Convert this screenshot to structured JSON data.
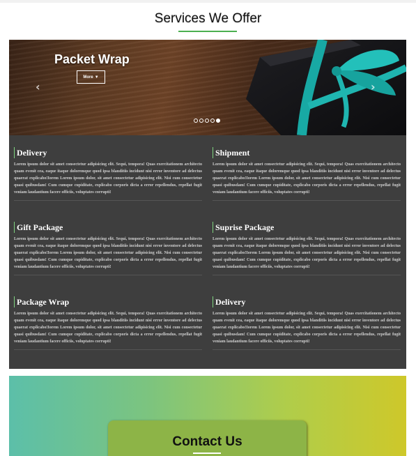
{
  "header": {
    "title": "Services We Offer"
  },
  "carousel": {
    "caption": "Packet Wrap",
    "more_label": "More",
    "prev_icon": "‹",
    "next_icon": "›",
    "indicators": 5,
    "active_indicator": 5
  },
  "services": [
    {
      "title": "Delivery",
      "text": "Lorem ipsum dolor sit amet consectetur adipisicing elit. Sequi, tempora! Quas exercitationem architecto quam evenit cea, eaque itaque doloremque quod ipsa blanditiis incidunt nisi error inventore ad delectus quaerat explicabo!Iorem Lorem ipsum dolor, sit amet consectetur adipisicing elit. Nisi cum consectetur quasi quibusdam! Cum cumque cupiditate, explicabo corporis dicta a error repellendus, repellat fugit veniam laudantium facere officiis, voluptates corrupti!"
    },
    {
      "title": "Shipment",
      "text": "Lorem ipsum dolor sit amet consectetur adipisicing elit. Sequi, tempora! Quas exercitationem architecto quam evenit cea, eaque itaque doloremque quod ipsa blanditiis incidunt nisi error inventore ad delectus quaerat explicabo!Iorem Lorem ipsum dolor, sit amet consectetur adipisicing elit. Nisi cum consectetur quasi quibusdam! Cum cumque cupiditate, explicabo corporis dicta a error repellendus, repellat fugit veniam laudantium facere officiis, voluptates corrupti!"
    },
    {
      "title": "Gift Package",
      "text": "Lorem ipsum dolor sit amet consectetur adipisicing elit. Sequi, tempora! Quas exercitationem architecto quam evenit cea, eaque itaque doloremque quod ipsa blanditiis incidunt nisi error inventore ad delectus quaerat explicabo!Iorem Lorem ipsum dolor, sit amet consectetur adipisicing elit. Nisi cum consectetur quasi quibusdam! Cum cumque cupiditate, explicabo corporis dicta a error repellendus, repellat fugit veniam laudantium facere officiis, voluptates corrupti!"
    },
    {
      "title": "Suprise Package",
      "text": "Lorem ipsum dolor sit amet consectetur adipisicing elit. Sequi, tempora! Quas exercitationem architecto quam evenit cea, eaque itaque doloremque quod ipsa blanditiis incidunt nisi error inventore ad delectus quaerat explicabo!Iorem Lorem ipsum dolor, sit amet consectetur adipisicing elit. Nisi cum consectetur quasi quibusdam! Cum cumque cupiditate, explicabo corporis dicta a error repellendus, repellat fugit veniam laudantium facere officiis, voluptates corrupti!"
    },
    {
      "title": "Package Wrap",
      "text": "Lorem ipsum dolor sit amet consectetur adipisicing elit. Sequi, tempora! Quas exercitationem architecto quam evenit cea, eaque itaque doloremque quod ipsa blanditiis incidunt nisi error inventore ad delectus quaerat explicabo!Iorem Lorem ipsum dolor, sit amet consectetur adipisicing elit. Nisi cum consectetur quasi quibusdam! Cum cumque cupiditate, explicabo corporis dicta a error repellendus, repellat fugit veniam laudantium facere officiis, voluptates corrupti!"
    },
    {
      "title": "Delivery",
      "text": "Lorem ipsum dolor sit amet consectetur adipisicing elit. Sequi, tempora! Quas exercitationem architecto quam evenit cea, eaque itaque doloremque quod ipsa blanditiis incidunt nisi error inventore ad delectus quaerat explicabo!Iorem Lorem ipsum dolor, sit amet consectetur adipisicing elit. Nisi cum consectetur quasi quibusdam! Cum cumque cupiditate, explicabo corporis dicta a error repellendus, repellat fugit veniam laudantium facere officiis, voluptates corrupti!"
    }
  ],
  "contact": {
    "title": "Contact Us"
  },
  "colors": {
    "accent_green": "#4caf50",
    "services_bg": "#3e3e3e",
    "ribbon_teal": "#1fb5b0",
    "contact_gradient_start": "#5cbfa9",
    "contact_gradient_end": "#cec82a"
  }
}
